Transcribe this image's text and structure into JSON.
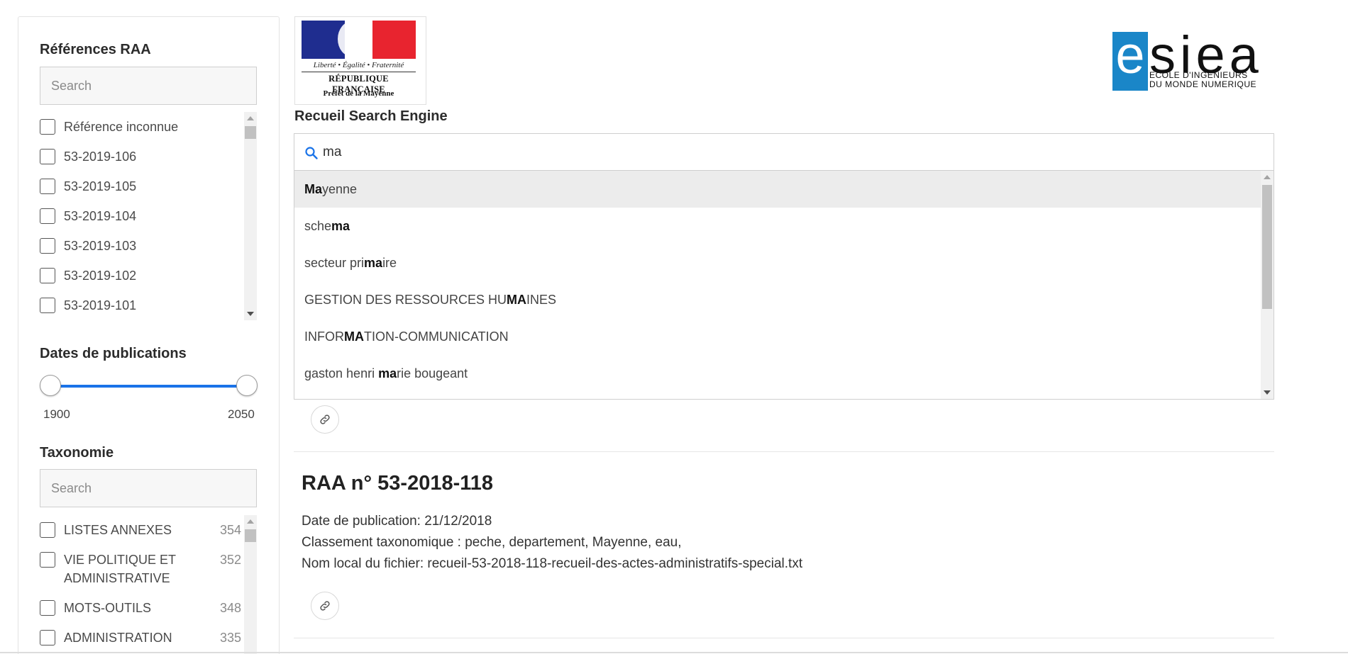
{
  "sidebar": {
    "raa": {
      "title": "Références RAA",
      "search_placeholder": "Search",
      "items": [
        "Référence inconnue",
        "53-2019-106",
        "53-2019-105",
        "53-2019-104",
        "53-2019-103",
        "53-2019-102",
        "53-2019-101"
      ]
    },
    "dates": {
      "title": "Dates de publications",
      "min": "1900",
      "max": "2050"
    },
    "taxonomy": {
      "title": "Taxonomie",
      "search_placeholder": "Search",
      "items": [
        {
          "label": "LISTES ANNEXES",
          "count": "354"
        },
        {
          "label": "VIE POLITIQUE ET ADMINISTRATIVE",
          "count": "352"
        },
        {
          "label": "MOTS-OUTILS",
          "count": "348"
        },
        {
          "label": "ADMINISTRATION",
          "count": "335"
        }
      ]
    }
  },
  "header": {
    "rf_motto": "Liberté • Égalité • Fraternité",
    "rf_name": "RÉPUBLIQUE FRANÇAISE",
    "rf_prefecture": "Préfet de la Mayenne",
    "esiea_e": "e",
    "esiea_rest": "siea",
    "esiea_tagline_1": "ECOLE D'INGENIEURS",
    "esiea_tagline_2": "DU MONDE NUMERIQUE"
  },
  "main": {
    "title": "Recueil Search Engine",
    "search_value": "ma",
    "suggestions": [
      {
        "pre": "",
        "match": "Ma",
        "post": "yenne"
      },
      {
        "pre": "sche",
        "match": "ma",
        "post": ""
      },
      {
        "pre": "secteur pri",
        "match": "ma",
        "post": "ire"
      },
      {
        "pre": "GESTION DES RESSOURCES HU",
        "match": "MA",
        "post": "INES"
      },
      {
        "pre": "INFOR",
        "match": "MA",
        "post": "TION-COMMUNICATION"
      },
      {
        "pre": "gaston henri ",
        "match": "ma",
        "post": "rie bougeant"
      }
    ],
    "result": {
      "title": "RAA n° 53-2018-118",
      "date": "Date de publication: 21/12/2018",
      "taxonomy": "Classement taxonomique : peche, departement, Mayenne, eau,",
      "filename": "Nom local du fichier: recueil-53-2018-118-recueil-des-actes-administratifs-special.txt"
    }
  },
  "colors": {
    "accent": "#1a73e8",
    "esiea_blue": "#1a86c8",
    "flag_blue": "#1f2d8f",
    "flag_red": "#e8242f"
  },
  "icons": {
    "search": "search-icon",
    "link": "link-icon"
  }
}
